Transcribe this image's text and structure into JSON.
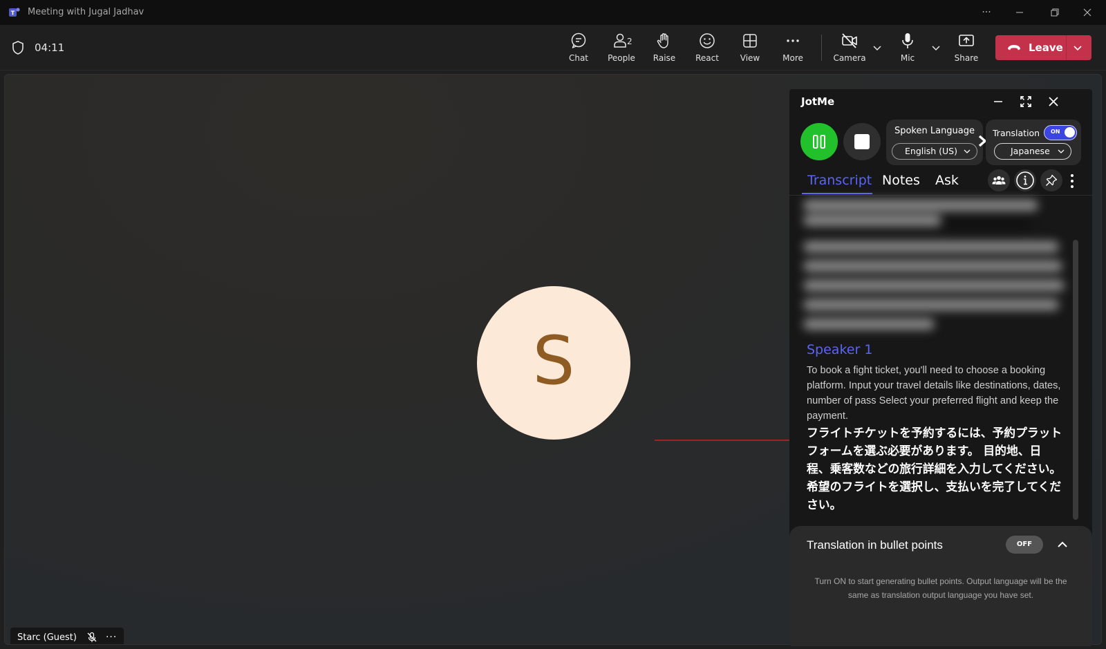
{
  "window": {
    "title": "Meeting with Jugal Jadhav"
  },
  "toolbar": {
    "timer": "04:11",
    "chat": "Chat",
    "people": "People",
    "people_count": "2",
    "raise": "Raise",
    "react": "React",
    "view": "View",
    "more": "More",
    "camera": "Camera",
    "mic": "Mic",
    "share": "Share",
    "leave": "Leave",
    "leave_color": "#c4314b"
  },
  "stage": {
    "avatar_initial": "S",
    "participant_name": "Starc (Guest)"
  },
  "jotme": {
    "title": "JotMe",
    "spoken_language_label": "Spoken Language",
    "spoken_language_value": "English (US)",
    "translation_label": "Translation",
    "translation_toggle": "ON",
    "translation_language": "Japanese",
    "tabs": [
      "Transcript",
      "Notes",
      "Ask"
    ],
    "speaker": "Speaker 1",
    "english_text": "To book a fight ticket, you'll need to choose a booking platform. Input your travel details like destinations, dates, number of pass Select your preferred flight and keep the payment.",
    "japanese_text": "フライトチケットを予約するには、予約プラットフォームを選ぶ必要があります。 目的地、日程、乗客数などの旅行詳細を入力してください。 希望のフライトを選択し、支払いを完了してください。",
    "bullets_title": "Translation in bullet points",
    "bullets_toggle": "OFF",
    "bullets_description": "Turn ON to start generating bullet points. Output language will be the same as translation output language you have set.",
    "accent_color": "#5b65f5",
    "record_color": "#22c02a"
  }
}
